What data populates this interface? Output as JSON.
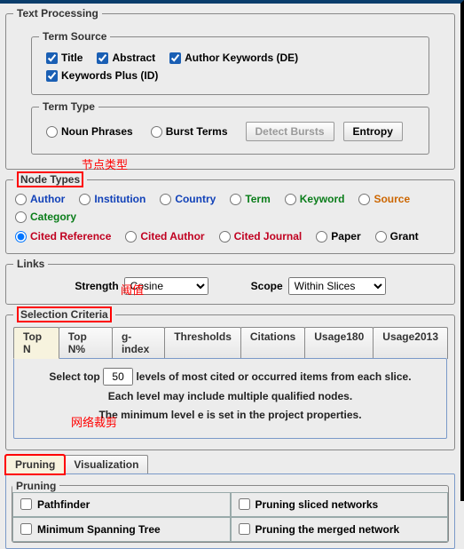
{
  "textProcessing": {
    "legend": "Text Processing",
    "termSource": {
      "legend": "Term Source",
      "title": "Title",
      "abstract": "Abstract",
      "authorKeywords": "Author Keywords (DE)",
      "keywordsPlus": "Keywords Plus (ID)"
    },
    "termType": {
      "legend": "Term Type",
      "nounPhrases": "Noun Phrases",
      "burstTerms": "Burst Terms",
      "detectBursts": "Detect Bursts",
      "entropy": "Entropy"
    }
  },
  "annotations": {
    "nodeTypes": "节点类型",
    "threshold": "阈值",
    "pruning": "网络裁剪"
  },
  "nodeTypes": {
    "legend": "Node Types",
    "author": "Author",
    "institution": "Institution",
    "country": "Country",
    "term": "Term",
    "keyword": "Keyword",
    "source": "Source",
    "category": "Category",
    "citedReference": "Cited Reference",
    "citedAuthor": "Cited Author",
    "citedJournal": "Cited Journal",
    "paper": "Paper",
    "grant": "Grant"
  },
  "links": {
    "legend": "Links",
    "strengthLabel": "Strength",
    "strengthValue": "Cosine",
    "scopeLabel": "Scope",
    "scopeValue": "Within Slices"
  },
  "selectionCriteria": {
    "legend": "Selection Criteria",
    "tabs": {
      "topN": "Top N",
      "topNPct": "Top N%",
      "gIndex": "g-index",
      "thresholds": "Thresholds",
      "citations": "Citations",
      "usage180": "Usage180",
      "usage2013": "Usage2013"
    },
    "selectTopPre": "Select top",
    "selectTopValue": "50",
    "selectTopPost": "levels of most cited or occurred items from each slice.",
    "line2": "Each level may include multiple qualified nodes.",
    "line3": "The minimum level e is set in the project properties."
  },
  "pruning": {
    "tabPruning": "Pruning",
    "tabVisualization": "Visualization",
    "legend": "Pruning",
    "pathfinder": "Pathfinder",
    "mst": "Minimum Spanning Tree",
    "pruneSliced": "Pruning sliced networks",
    "pruneMerged": "Pruning the merged network"
  }
}
